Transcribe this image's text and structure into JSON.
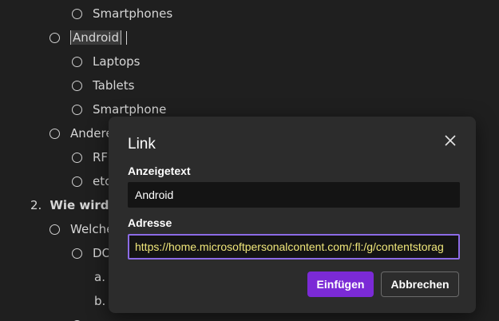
{
  "document": {
    "items": [
      {
        "text": "Smartphones",
        "type": "bullet"
      },
      {
        "text": "Android",
        "type": "bullet"
      },
      {
        "text": "Laptops",
        "type": "bullet"
      },
      {
        "text": "Tablets",
        "type": "bullet"
      },
      {
        "text": "Smartphone",
        "type": "bullet"
      },
      {
        "text": "Andere",
        "type": "bullet"
      },
      {
        "text": "RF",
        "type": "bullet"
      },
      {
        "text": "etc",
        "type": "bullet"
      },
      {
        "number": "2.",
        "text": "Wie wird",
        "type": "numbered"
      },
      {
        "text": "Welche",
        "type": "bullet"
      },
      {
        "text": "DO",
        "type": "bullet"
      },
      {
        "number": "a.",
        "text": "",
        "type": "lettered"
      },
      {
        "number": "b.",
        "text": "",
        "type": "lettered"
      }
    ]
  },
  "dialog": {
    "title": "Link",
    "display_text_label": "Anzeigetext",
    "display_text_value": "Android",
    "address_label": "Adresse",
    "address_value": "https://home.microsoftpersonalcontent.com/:fl:/g/contentstorag",
    "insert_label": "Einfügen",
    "cancel_label": "Abbrechen",
    "close_icon": "close-icon"
  },
  "colors": {
    "background": "#1f1f1f",
    "dialog_bg": "#2c2c2c",
    "accent": "#7b2ad6",
    "focus_border": "#8c6be6",
    "address_text": "#f0e77a"
  }
}
